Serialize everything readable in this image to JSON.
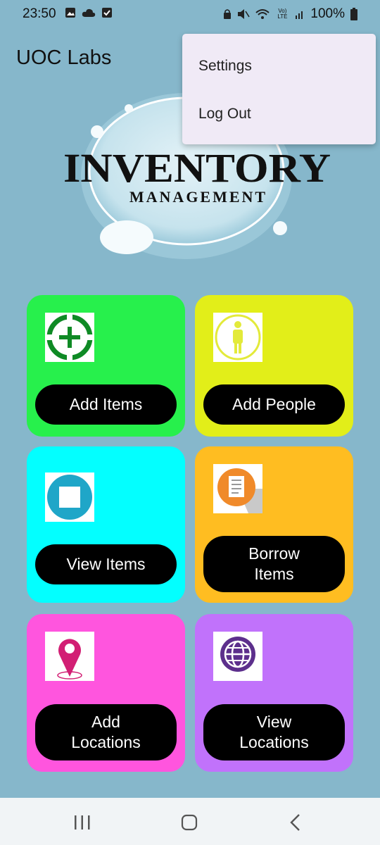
{
  "status_bar": {
    "time": "23:50",
    "battery": "100%",
    "left_icons": [
      "image-icon",
      "cloud-icon",
      "checkbox-icon"
    ],
    "right_icons": [
      "lock-icon",
      "mute-icon",
      "wifi-icon",
      "volte-icon",
      "signal-icon",
      "battery-icon"
    ],
    "volte_label": "Vo) LTE"
  },
  "app_bar": {
    "title": "UOC Labs"
  },
  "overflow_menu": {
    "items": [
      "Settings",
      "Log Out"
    ]
  },
  "banner": {
    "title": "INVENTORY",
    "subtitle": "MANAGEMENT"
  },
  "tiles": [
    {
      "label": "Add Items",
      "icon": "add-circle-icon",
      "color": "#27f04c"
    },
    {
      "label": "Add People",
      "icon": "person-icon",
      "color": "#e2ee19"
    },
    {
      "label": "View Items",
      "icon": "stop-square-icon",
      "color": "#03ffff"
    },
    {
      "label": "Borrow\nItems",
      "icon": "document-list-icon",
      "color": "#ffbd21"
    },
    {
      "label": "Add\nLocations",
      "icon": "map-pin-icon",
      "color": "#ff55de"
    },
    {
      "label": "View\nLocations",
      "icon": "globe-icon",
      "color": "#c172fb"
    }
  ],
  "nav_bar": {
    "buttons": [
      "recent-apps-icon",
      "home-icon",
      "back-icon"
    ]
  },
  "colors": {
    "background": "#86b7cb",
    "menu": "#f0eaf6",
    "navbar": "#f1f4f6"
  }
}
